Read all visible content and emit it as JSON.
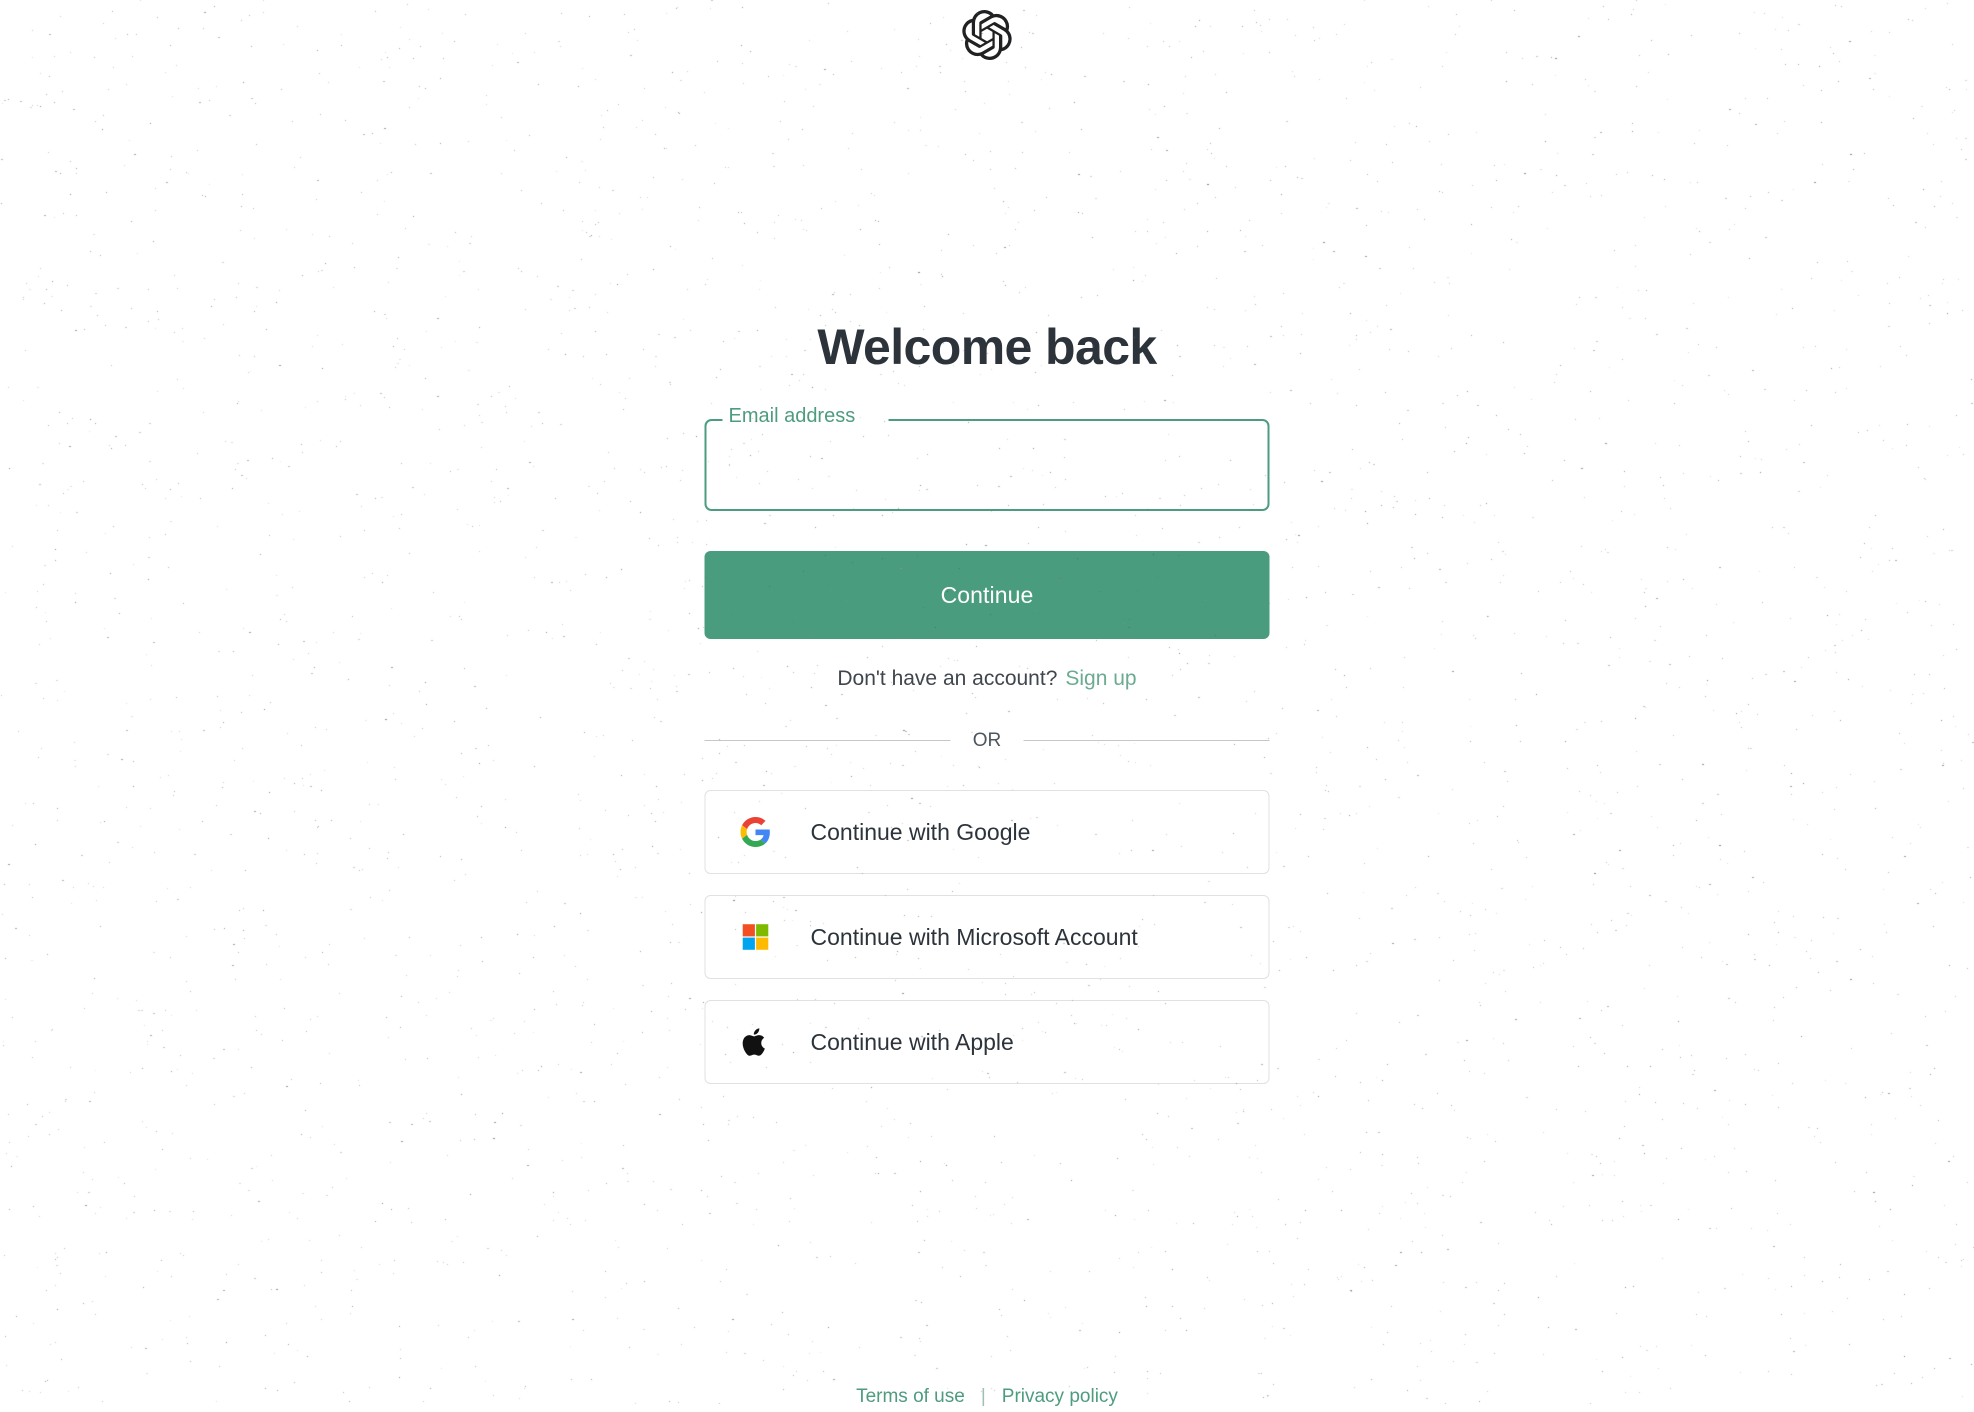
{
  "brand": {
    "logo_icon": "openai-logo-icon",
    "logo_color": "#202123"
  },
  "main": {
    "title": "Welcome back",
    "email_field": {
      "label": "Email address",
      "value": "",
      "placeholder": "",
      "border_color": "#4e9c7f"
    },
    "continue_button": {
      "label": "Continue",
      "background": "#4a9c7e",
      "text_color": "#ffffff"
    },
    "signup": {
      "prompt": "Don't have an account?",
      "link_label": "Sign up",
      "link_color": "#6cab90"
    },
    "divider_label": "OR",
    "social_buttons": [
      {
        "icon": "google-icon",
        "label": "Continue with Google"
      },
      {
        "icon": "microsoft-icon",
        "label": "Continue with Microsoft Account"
      },
      {
        "icon": "apple-icon",
        "label": "Continue with Apple"
      }
    ]
  },
  "footer": {
    "terms_label": "Terms of use",
    "separator": "|",
    "privacy_label": "Privacy policy",
    "link_color": "#4e9c7f"
  }
}
